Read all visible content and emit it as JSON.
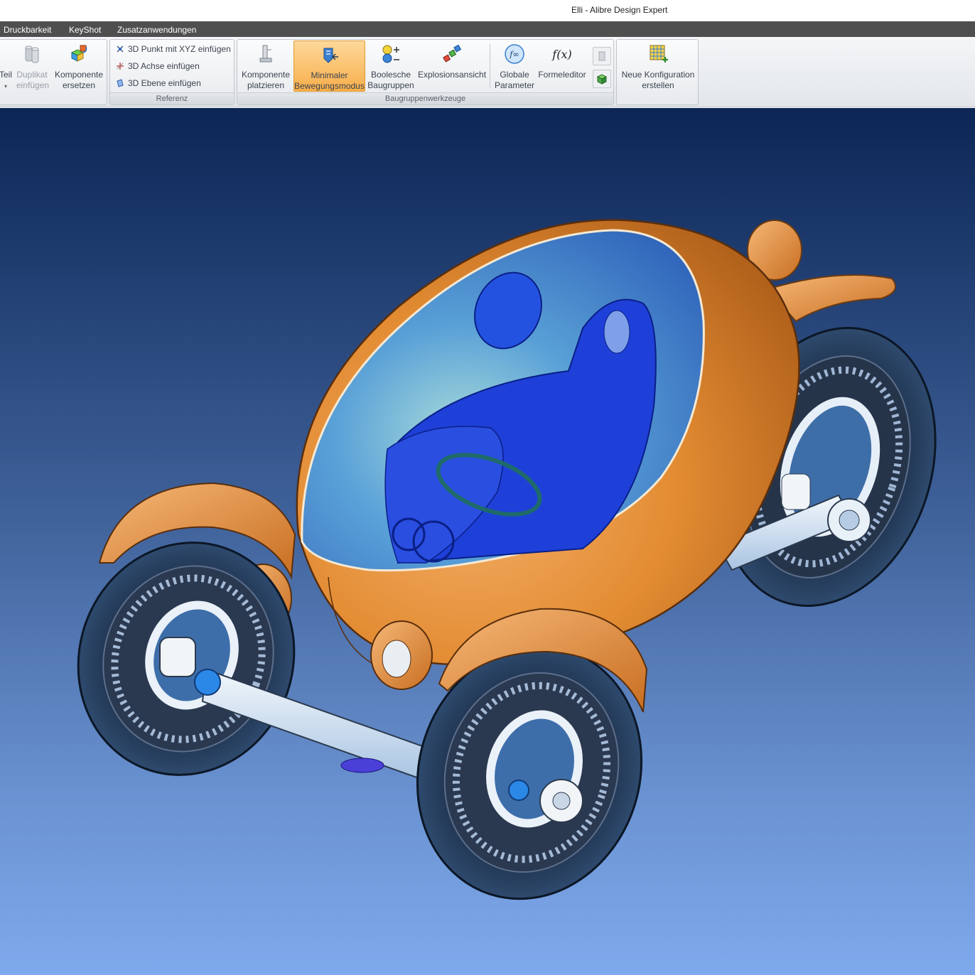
{
  "window": {
    "title": "Elli - Alibre Design Expert"
  },
  "menu": {
    "items": [
      "Druckbarkeit",
      "KeyShot",
      "Zusatzanwendungen"
    ]
  },
  "ribbon": {
    "group1": {
      "teil_label": "Teil",
      "duplikat": {
        "line1": "Duplikat",
        "line2": "einfügen"
      },
      "komponente_ersetzen": {
        "line1": "Komponente",
        "line2": "ersetzen"
      }
    },
    "referenz": {
      "label": "Referenz",
      "items": [
        "3D Punkt mit XYZ einfügen",
        "3D Achse einfügen",
        "3D Ebene einfügen"
      ]
    },
    "baugruppenwerkzeuge": {
      "label": "Baugruppenwerkzeuge",
      "komponente_platzieren": {
        "line1": "Komponente",
        "line2": "platzieren"
      },
      "minimaler": {
        "line1": "Minimaler",
        "line2": "Bewegungsmodus"
      },
      "boolesche": {
        "line1": "Boolesche",
        "line2": "Baugruppen"
      },
      "explosionsansicht": {
        "line1": "Explosionsansicht"
      },
      "globale": {
        "line1": "Globale",
        "line2": "Parameter"
      },
      "formeleditor": {
        "line1": "Formeleditor"
      }
    },
    "konfiguration": {
      "line1": "Neue Konfiguration",
      "line2": "erstellen"
    }
  },
  "colors": {
    "menubar": "#4f4f4f",
    "accent_active": "#f7ae4a",
    "body_orange": "#e8902f",
    "canopy_blue": "#3f8fe6",
    "viewport_top": "#0c2656",
    "viewport_bottom": "#7ea9ec"
  }
}
